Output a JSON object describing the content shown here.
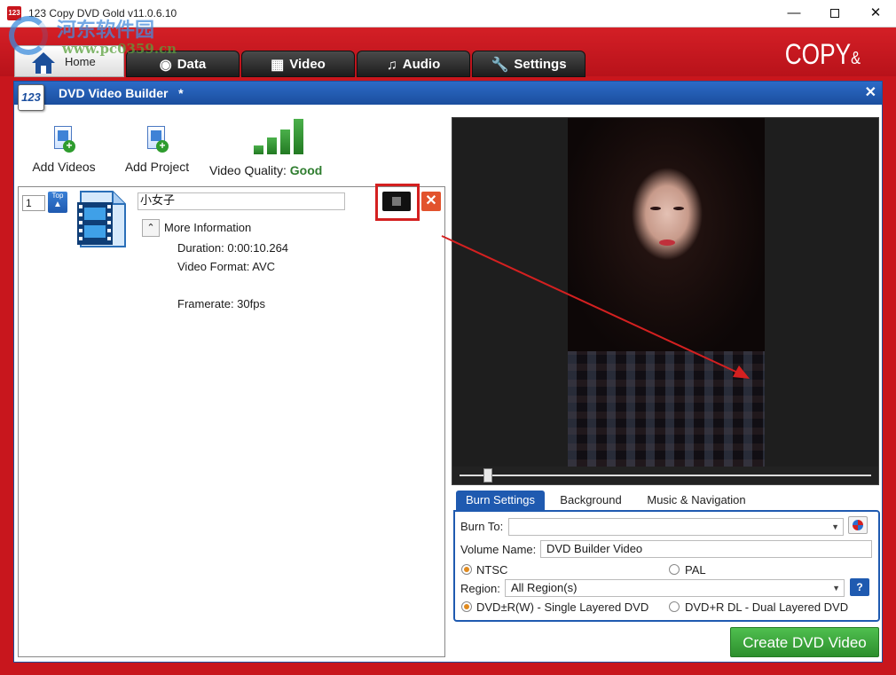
{
  "window": {
    "title": "123 Copy DVD Gold v11.0.6.10",
    "icon_text": "123",
    "minimize": "—",
    "close": "✕"
  },
  "watermark": {
    "text": "河东软件园",
    "url": "www.pc0359.cn"
  },
  "header": {
    "brand": "COPY",
    "brand_suffix": "&",
    "tabs": [
      {
        "label": "Home",
        "icon": "house-icon"
      },
      {
        "label": "Data",
        "icon": "disc-icon"
      },
      {
        "label": "Video",
        "icon": "film-icon"
      },
      {
        "label": "Audio",
        "icon": "music-note-icon"
      },
      {
        "label": "Settings",
        "icon": "wrench-icon"
      }
    ]
  },
  "builder": {
    "logo": "123",
    "title": "DVD Video Builder",
    "modified_mark": "*",
    "close": "✕",
    "toolbar": {
      "add_videos": "Add Videos",
      "add_project": "Add Project",
      "quality_label": "Video Quality:",
      "quality_value": "Good",
      "quality_bars": 4
    },
    "video_item": {
      "index": "1",
      "top_label": "Top",
      "name": "小女子",
      "more_information": "More Information",
      "duration": "Duration: 0:00:10.264",
      "format": "Video Format: AVC",
      "framerate": "Framerate: 30fps",
      "delete": "✕",
      "collapse": "⌃"
    },
    "preview": {
      "seek_position": 0.04
    },
    "settings_tabs": [
      "Burn Settings",
      "Background",
      "Music & Navigation"
    ],
    "burn": {
      "burn_to_label": "Burn To:",
      "burn_to_value": "",
      "volume_label": "Volume Name:",
      "volume_value": "DVD Builder Video",
      "ntsc": "NTSC",
      "pal": "PAL",
      "region_label": "Region:",
      "region_value": "All Region(s)",
      "single_layer": "DVD±R(W) - Single Layered DVD",
      "dual_layer": "DVD+R DL - Dual Layered DVD",
      "help": "?"
    },
    "create_button": "Create DVD Video"
  },
  "colors": {
    "header_red": "#c8161d",
    "accent_blue": "#1f5ab0",
    "create_green": "#3aa83a",
    "annotation_red": "#d42020"
  }
}
